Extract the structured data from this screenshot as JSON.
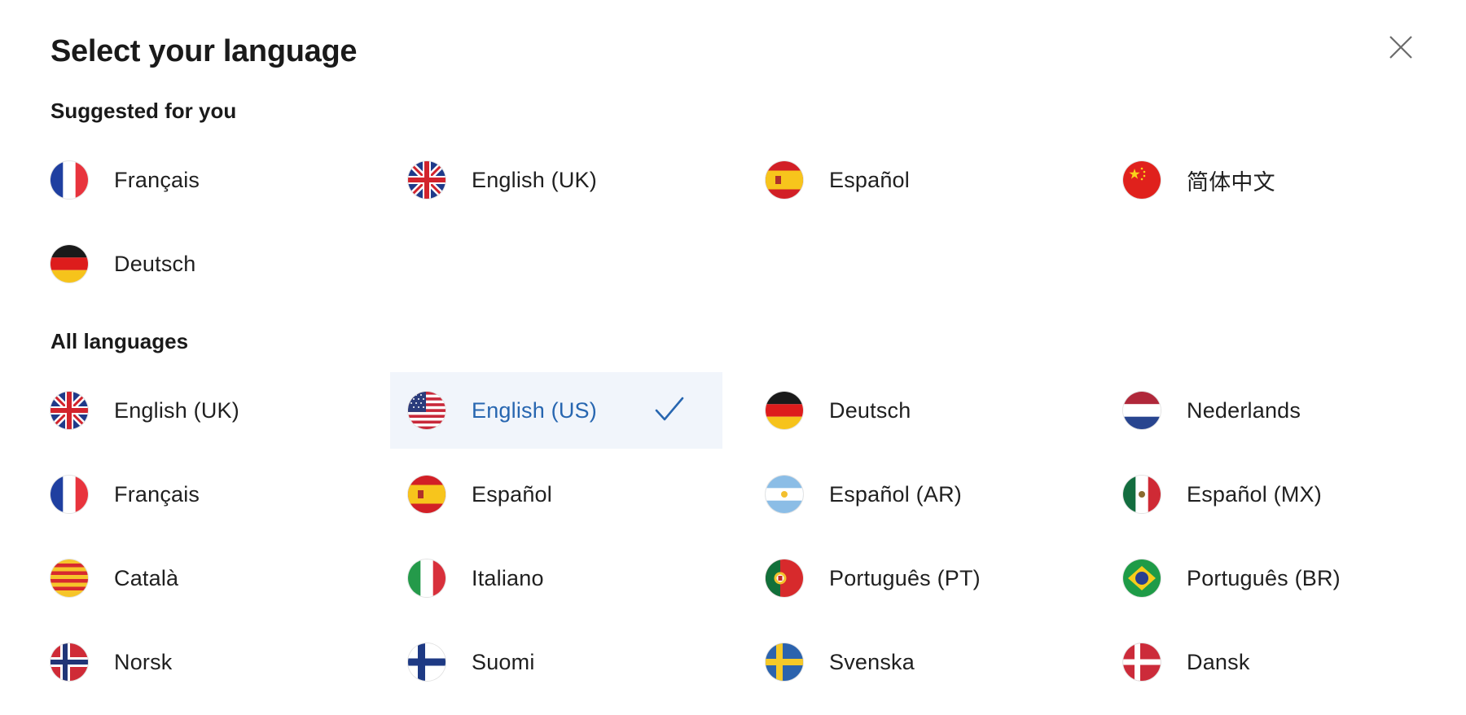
{
  "modal": {
    "title": "Select your language",
    "close_icon": "close-icon"
  },
  "suggested": {
    "heading": "Suggested for you",
    "items": [
      {
        "label": "Français",
        "flag": "flag-fr"
      },
      {
        "label": "English (UK)",
        "flag": "flag-gb"
      },
      {
        "label": "Español",
        "flag": "flag-es"
      },
      {
        "label": "简体中文",
        "flag": "flag-cn"
      },
      {
        "label": "Deutsch",
        "flag": "flag-de"
      }
    ]
  },
  "all": {
    "heading": "All languages",
    "selected": "English (US)",
    "items": [
      {
        "label": "English (UK)",
        "flag": "flag-gb"
      },
      {
        "label": "English (US)",
        "flag": "flag-us"
      },
      {
        "label": "Deutsch",
        "flag": "flag-de"
      },
      {
        "label": "Nederlands",
        "flag": "flag-nl"
      },
      {
        "label": "Français",
        "flag": "flag-fr"
      },
      {
        "label": "Español",
        "flag": "flag-es"
      },
      {
        "label": "Español (AR)",
        "flag": "flag-ar"
      },
      {
        "label": "Español (MX)",
        "flag": "flag-mx"
      },
      {
        "label": "Català",
        "flag": "flag-cat"
      },
      {
        "label": "Italiano",
        "flag": "flag-it"
      },
      {
        "label": "Português (PT)",
        "flag": "flag-pt"
      },
      {
        "label": "Português (BR)",
        "flag": "flag-br"
      },
      {
        "label": "Norsk",
        "flag": "flag-no"
      },
      {
        "label": "Suomi",
        "flag": "flag-fi"
      },
      {
        "label": "Svenska",
        "flag": "flag-se"
      },
      {
        "label": "Dansk",
        "flag": "flag-dk"
      }
    ]
  },
  "colors": {
    "selected_bg": "#f1f5fb",
    "selected_text": "#2766b0",
    "text": "#1f1f1f"
  }
}
